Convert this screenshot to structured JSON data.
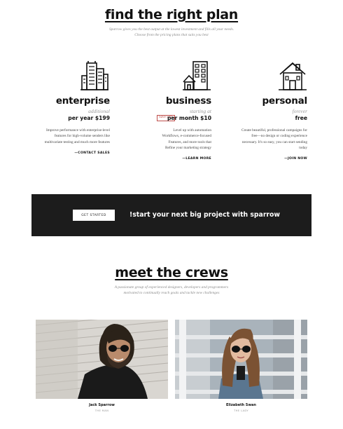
{
  "pricing": {
    "title": "find the right plan",
    "subtitle_line1": "Sparrow gives you the best output at the lowest investment and fills all your needs.",
    "subtitle_line2": "Choose from the pricing plans that suits you best",
    "plans": [
      {
        "icon": "office-building-icon",
        "name": "enterprise",
        "tagline": "additional",
        "price": "per year $199",
        "badge": "",
        "description": [
          "Improve performance with enterprise-level",
          "features for high-volume senders like",
          "multivariate testing and much more features"
        ],
        "link": "—CONTACT SALES"
      },
      {
        "icon": "store-building-icon",
        "name": "business",
        "tagline": "starting at",
        "price": "per month $10",
        "badge": "Save 50%",
        "description": [
          "Level up with automation",
          "Workflows, e-commerce-focused",
          "Features, and more tools that",
          "Refine your marketing strategy"
        ],
        "link": "—LEARN MORE"
      },
      {
        "icon": "house-icon",
        "name": "personal",
        "tagline": "forever",
        "price": "free",
        "badge": "",
        "description": [
          "Create beautiful, professional campaigns for",
          "free—no design or coding experience",
          "necessary. It's so easy, you can start sending",
          "today"
        ],
        "link": "—JOIN NOW"
      }
    ]
  },
  "banner": {
    "button_label": "GET STARTED",
    "text": "!start your next big project with sparrow",
    "background": "#1c1c1c"
  },
  "crew": {
    "title": "meet the crews",
    "subtitle_line1": "A passionate group of experienced designers, developers and programmers",
    "subtitle_line2": "motivated to continually reach goals and tackle new challenges",
    "members": [
      {
        "name": "Jack Sparrow",
        "role": "THE MAN"
      },
      {
        "name": "Elizabeth Swan",
        "role": "THE LADY"
      }
    ]
  }
}
